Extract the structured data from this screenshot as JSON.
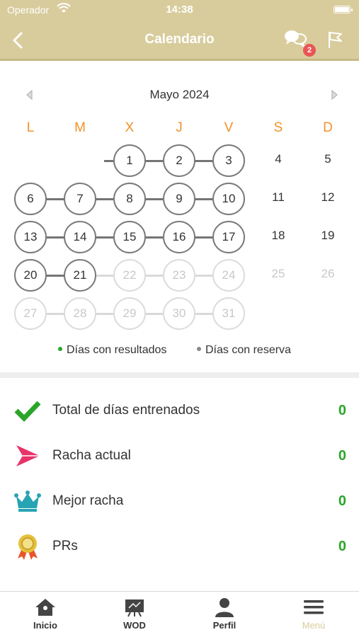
{
  "status_bar": {
    "carrier": "Operador",
    "time": "14:38"
  },
  "header": {
    "title": "Calendario",
    "chat_badge": "2"
  },
  "colors": {
    "header_bg": "#d8cc9c",
    "weekday": "#f0932b",
    "value_green": "#2aa52a",
    "badge_red": "#ea5455"
  },
  "calendar": {
    "month_label": "Mayo 2024",
    "weekdays": [
      "L",
      "M",
      "X",
      "J",
      "V",
      "S",
      "D"
    ],
    "weeks": [
      [
        null,
        null,
        {
          "d": "1",
          "s": "active"
        },
        {
          "d": "2",
          "s": "active"
        },
        {
          "d": "3",
          "s": "active"
        },
        {
          "d": "4",
          "s": "plain"
        },
        {
          "d": "5",
          "s": "plain"
        }
      ],
      [
        {
          "d": "6",
          "s": "active"
        },
        {
          "d": "7",
          "s": "active"
        },
        {
          "d": "8",
          "s": "active"
        },
        {
          "d": "9",
          "s": "active"
        },
        {
          "d": "10",
          "s": "active"
        },
        {
          "d": "11",
          "s": "plain"
        },
        {
          "d": "12",
          "s": "plain"
        }
      ],
      [
        {
          "d": "13",
          "s": "active"
        },
        {
          "d": "14",
          "s": "active"
        },
        {
          "d": "15",
          "s": "active"
        },
        {
          "d": "16",
          "s": "active"
        },
        {
          "d": "17",
          "s": "active"
        },
        {
          "d": "18",
          "s": "plain"
        },
        {
          "d": "19",
          "s": "plain"
        }
      ],
      [
        {
          "d": "20",
          "s": "active"
        },
        {
          "d": "21",
          "s": "active"
        },
        {
          "d": "22",
          "s": "future"
        },
        {
          "d": "23",
          "s": "future"
        },
        {
          "d": "24",
          "s": "future"
        },
        {
          "d": "25",
          "s": "plain-future"
        },
        {
          "d": "26",
          "s": "plain-future"
        }
      ],
      [
        {
          "d": "27",
          "s": "future"
        },
        {
          "d": "28",
          "s": "future"
        },
        {
          "d": "29",
          "s": "future"
        },
        {
          "d": "30",
          "s": "future"
        },
        {
          "d": "31",
          "s": "future"
        },
        null,
        null
      ]
    ],
    "legend": {
      "results": "Días con resultados",
      "reservations": "Días con reserva"
    }
  },
  "stats": [
    {
      "icon": "checkmark-icon",
      "label": "Total de días entrenados",
      "value": "0"
    },
    {
      "icon": "paper-plane-icon",
      "label": "Racha actual",
      "value": "0"
    },
    {
      "icon": "crown-icon",
      "label": "Mejor racha",
      "value": "0"
    },
    {
      "icon": "medal-icon",
      "label": "PRs",
      "value": "0"
    }
  ],
  "tabbar": [
    {
      "icon": "home-icon",
      "label": "Inicio",
      "active": false
    },
    {
      "icon": "whiteboard-icon",
      "label": "WOD",
      "active": false
    },
    {
      "icon": "user-icon",
      "label": "Perfil",
      "active": false
    },
    {
      "icon": "menu-icon",
      "label": "Menú",
      "active": true
    }
  ]
}
